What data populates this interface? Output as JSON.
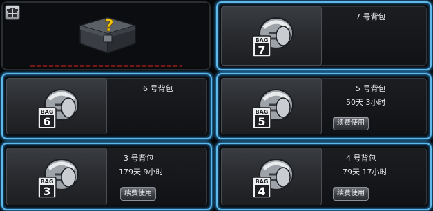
{
  "colors": {
    "glow": "#5fb8ea",
    "text": "#e8e8e8",
    "icon_bg": "#2a2c30"
  },
  "gift_slot": {
    "icon": "gift-icon",
    "chest_icon": "mystery-chest-icon"
  },
  "slots": [
    {
      "id": "bag7",
      "name": "7 号背包",
      "number": "7",
      "bag_label": "BAG"
    },
    {
      "id": "bag6",
      "name": "6 号背包",
      "number": "6",
      "bag_label": "BAG"
    },
    {
      "id": "bag5",
      "name": "5 号背包",
      "number": "5",
      "bag_label": "BAG",
      "time": "50天 3小时",
      "renew_label": "续费使用"
    },
    {
      "id": "bag3",
      "name": "3 号背包",
      "number": "3",
      "bag_label": "BAG",
      "time": "179天 9小时",
      "renew_label": "续费使用"
    },
    {
      "id": "bag4",
      "name": "4 号背包",
      "number": "4",
      "bag_label": "BAG",
      "time": "79天 17小时",
      "renew_label": "续费使用"
    }
  ]
}
